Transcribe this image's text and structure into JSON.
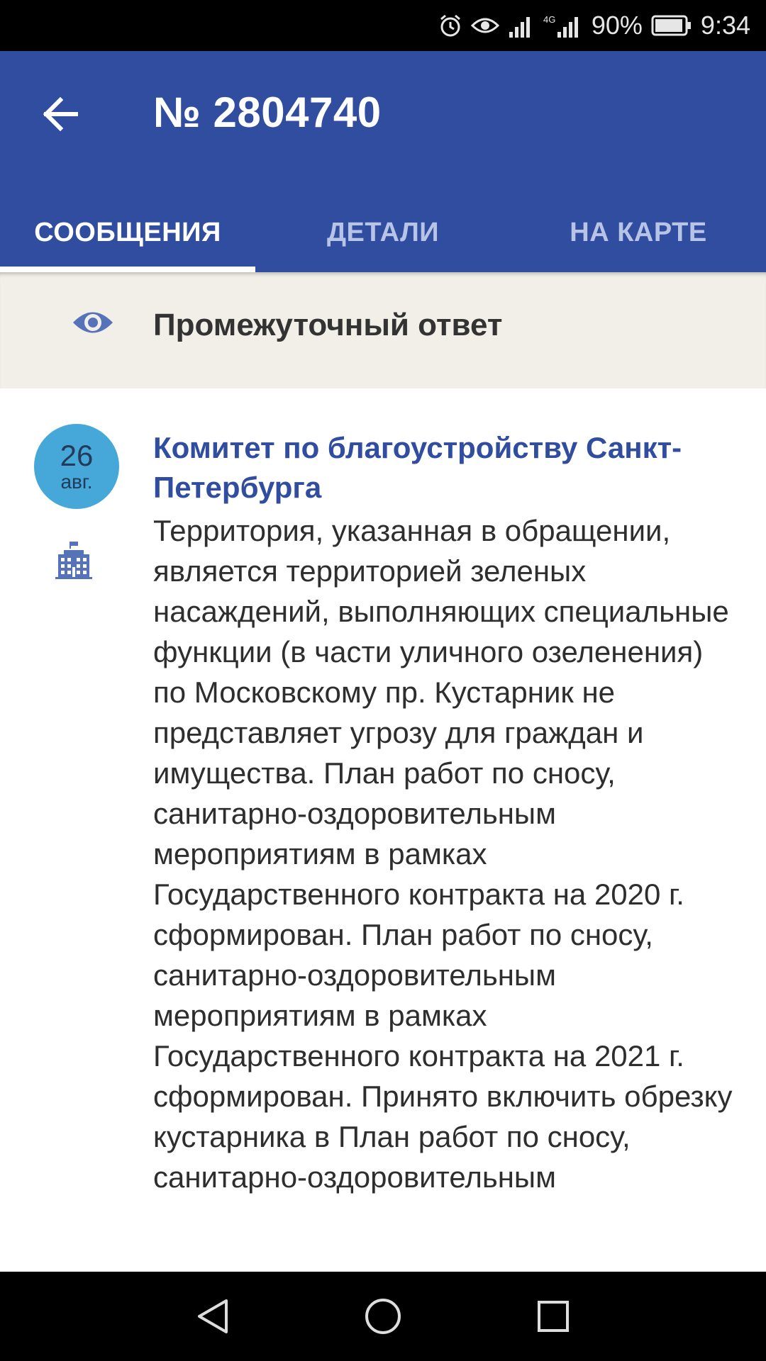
{
  "status_bar": {
    "network": "4G",
    "battery": "90%",
    "time": "9:34",
    "icons": [
      "alarm-icon",
      "eye-icon",
      "signal-icon",
      "signal-4g-icon",
      "battery-icon"
    ]
  },
  "header": {
    "title": "№ 2804740",
    "back_icon": "arrow-left-icon"
  },
  "tabs": [
    {
      "label": "СООБЩЕНИЯ",
      "active": true
    },
    {
      "label": "ДЕТАЛИ",
      "active": false
    },
    {
      "label": "НА КАРТЕ",
      "active": false
    }
  ],
  "status_row": {
    "icon": "eye-icon",
    "text": "Промежуточный ответ"
  },
  "message": {
    "date_day": "26",
    "date_month": "авг.",
    "org_icon": "government-building-icon",
    "author": "Комитет по благоустройству Санкт-Петербурга",
    "text": "Территория, указанная в обращении, является территорией зеленых насаждений, выполняющих специальные функции (в части уличного озеленения) по Московскому пр. Кустарник не представляет угрозу для граждан и имущества. План работ по сносу, санитарно-оздоровительным мероприятиям в рамках Государственного контракта на 2020 г. сформирован. План работ по сносу, санитарно-оздоровительным мероприятиям в рамках Государственного контракта на 2021 г. сформирован. Принято включить обрезку кустарника в План работ по сносу, санитарно-оздоровительным"
  },
  "colors": {
    "primary": "#314da0",
    "accent_badge": "#45a8d8",
    "status_background": "#f1efe8"
  },
  "nav_bar": {
    "icons": [
      "back-triangle-icon",
      "home-circle-icon",
      "recents-square-icon"
    ]
  }
}
